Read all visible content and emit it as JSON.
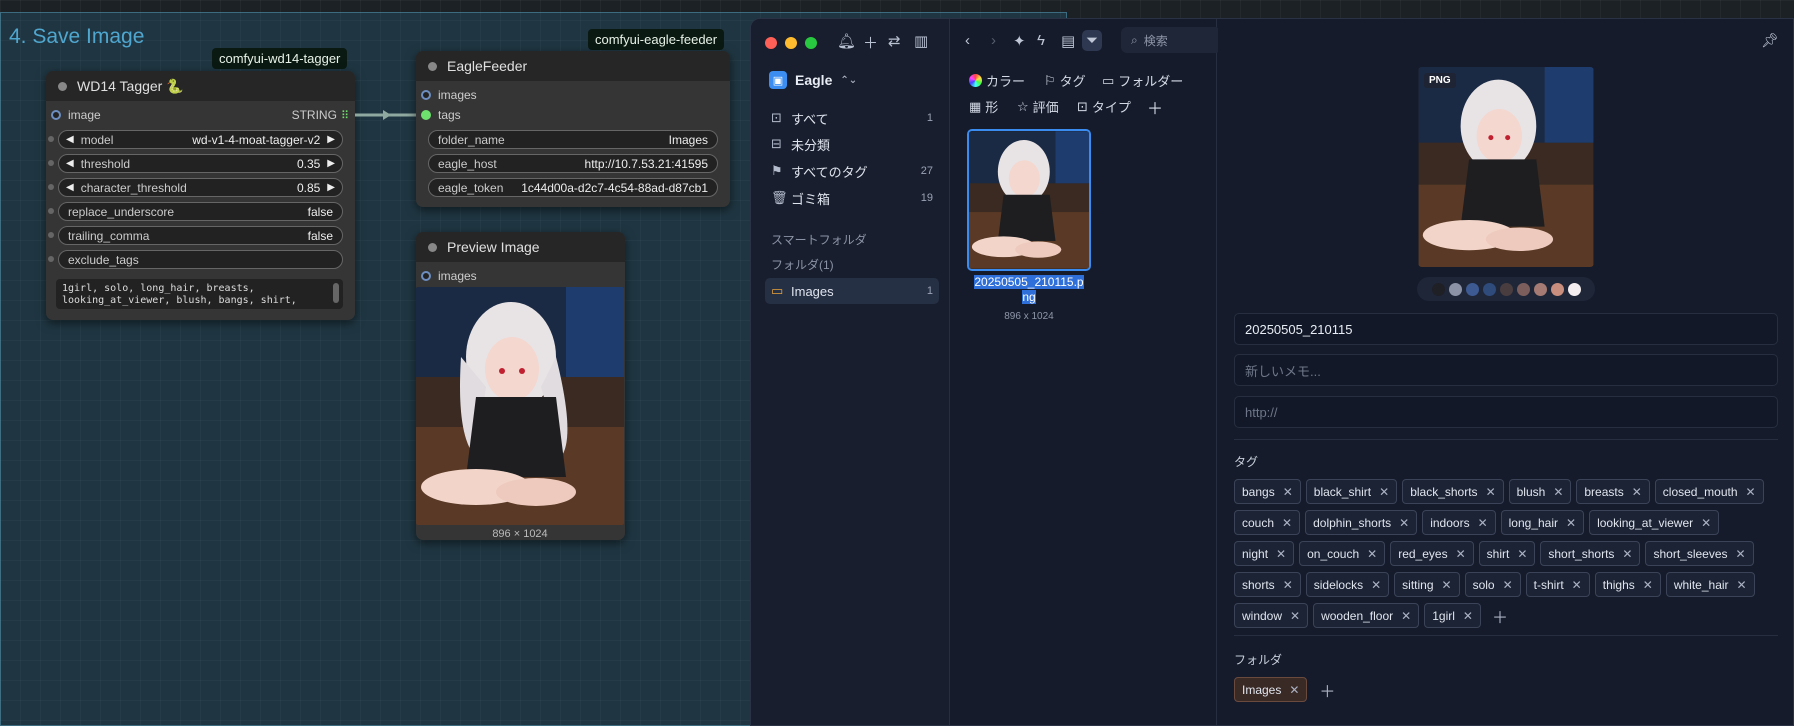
{
  "group": {
    "title": "4. Save Image"
  },
  "badges": {
    "tagger": "comfyui-wd14-tagger",
    "feeder": "comfyui-eagle-feeder"
  },
  "tagger_node": {
    "title": "WD14 Tagger 🐍",
    "input": "image",
    "output": "STRING",
    "widgets": {
      "model": {
        "label": "model",
        "value": "wd-v1-4-moat-tagger-v2"
      },
      "threshold": {
        "label": "threshold",
        "value": "0.35"
      },
      "character_threshold": {
        "label": "character_threshold",
        "value": "0.85"
      },
      "replace_underscore": {
        "label": "replace_underscore",
        "value": "false"
      },
      "trailing_comma": {
        "label": "trailing_comma",
        "value": "false"
      },
      "exclude_tags": {
        "label": "exclude_tags",
        "value": ""
      }
    },
    "output_text": "1girl, solo, long_hair, breasts, looking_at_viewer, blush, bangs, shirt,"
  },
  "feeder_node": {
    "title": "EagleFeeder",
    "inputs": [
      "images",
      "tags"
    ],
    "widgets": {
      "folder_name": {
        "label": "folder_name",
        "value": "Images"
      },
      "eagle_host": {
        "label": "eagle_host",
        "value": "http://10.7.53.21:41595"
      },
      "eagle_token": {
        "label": "eagle_token",
        "value": "1c44d00a-d2c7-4c54-88ad-d87cb1"
      }
    }
  },
  "preview_node": {
    "title": "Preview Image",
    "input": "images",
    "dims": "896 × 1024"
  },
  "eagle": {
    "library": "Eagle",
    "sidebar": [
      {
        "label": "すべて",
        "count": "1"
      },
      {
        "label": "未分類",
        "count": ""
      },
      {
        "label": "すべてのタグ",
        "count": "27"
      },
      {
        "label": "ゴミ箱",
        "count": "19"
      }
    ],
    "smart_folder": "スマートフォルダ",
    "folders_heading": "フォルダ(1)",
    "folder": {
      "label": "Images",
      "count": "1"
    },
    "search_placeholder": "検索",
    "filters": {
      "color": "カラー",
      "tag": "タグ",
      "folder": "フォルダー",
      "shape": "形",
      "rating": "評価",
      "type": "タイプ"
    },
    "thumbnail": {
      "name_line1": "20250505_210115.p",
      "name_line2": "ng",
      "dims": "896 x 1024"
    },
    "inspector": {
      "badge": "PNG",
      "name": "20250505_210115",
      "memo_placeholder": "新しいメモ...",
      "url_placeholder": "http://",
      "tags_heading": "タグ",
      "folder_heading": "フォルダ",
      "folder_value": "Images"
    },
    "swatch_colors": [
      "#1f1f26",
      "#8c93a6",
      "#3d5a93",
      "#2e4b7c",
      "#4a3d3f",
      "#7c5e5c",
      "#a57b73",
      "#c98e7d",
      "#f5eef0"
    ],
    "tags": [
      "bangs",
      "black_shirt",
      "black_shorts",
      "blush",
      "breasts",
      "closed_mouth",
      "couch",
      "dolphin_shorts",
      "indoors",
      "long_hair",
      "looking_at_viewer",
      "night",
      "on_couch",
      "red_eyes",
      "shirt",
      "short_shorts",
      "short_sleeves",
      "shorts",
      "sidelocks",
      "sitting",
      "solo",
      "t-shirt",
      "thighs",
      "white_hair",
      "window",
      "wooden_floor",
      "1girl"
    ]
  }
}
